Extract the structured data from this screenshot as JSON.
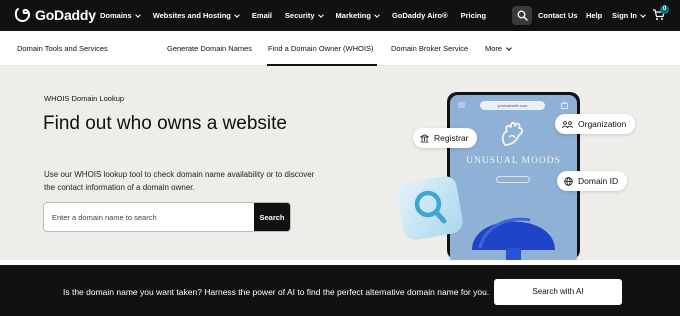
{
  "topnav": {
    "logo_text": "GoDaddy",
    "items": [
      {
        "label": "Domains",
        "has_chevron": true
      },
      {
        "label": "Websites and Hosting",
        "has_chevron": true
      },
      {
        "label": "Email",
        "has_chevron": false
      },
      {
        "label": "Security",
        "has_chevron": true
      },
      {
        "label": "Marketing",
        "has_chevron": true
      },
      {
        "label": "GoDaddy Airo®",
        "has_chevron": false
      },
      {
        "label": "Pricing",
        "has_chevron": false
      }
    ],
    "contact_label": "Contact Us",
    "help_label": "Help",
    "signin_label": "Sign In",
    "cart_count": "0",
    "search_icon": "search-icon",
    "cart_icon": "cart-icon"
  },
  "subnav": {
    "title": "Domain Tools and Services",
    "items": [
      "Generate Domain Names",
      "Find a Domain Owner (WHOIS)",
      "Domain Broker Service"
    ],
    "more_label": "More",
    "active_index": 1
  },
  "hero": {
    "eyebrow": "WHOIS Domain Lookup",
    "headline": "Find out who owns a website",
    "description": "Use our WHOIS lookup tool to check domain name availability or to discover the contact information of a domain owner.",
    "search_placeholder": "Enter a domain name to search",
    "search_button": "Search"
  },
  "illustration": {
    "url": "yourwebsite.com",
    "brand": "UNUSUAL MOODS",
    "tags": [
      "Registrar",
      "Organization",
      "Domain ID"
    ]
  },
  "banner": {
    "text": "Is the domain name you want taken? Harness the power of AI to find the perfect alternative domain name for you.",
    "button": "Search with AI"
  },
  "colors": {
    "nav_bg": "#111111",
    "hero_bg": "#efedea",
    "accent_teal": "#09757a",
    "phone_screen": "#8fb1d6"
  }
}
